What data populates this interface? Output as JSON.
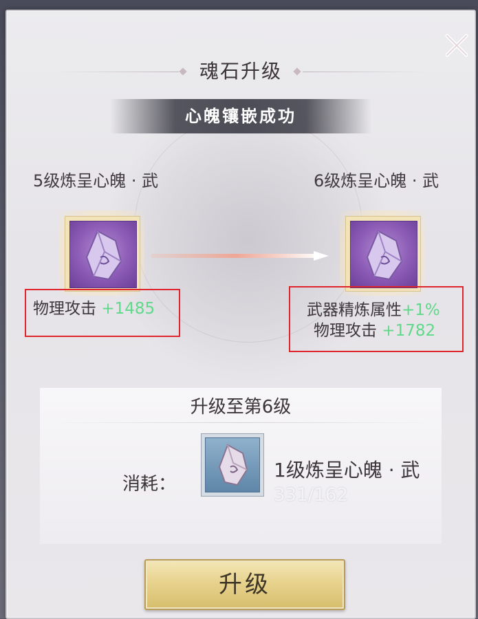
{
  "dialog": {
    "title": "魂石升级",
    "banner": "心魄镶嵌成功",
    "close_icon": "close-x-icon"
  },
  "current_item": {
    "name": "5级炼呈心魄 · 武",
    "icon": "soul-stone-crystal-icon",
    "stats": [
      {
        "label": "物理攻击",
        "value": "+1485"
      }
    ]
  },
  "next_item": {
    "name": "6级炼呈心魄 · 武",
    "icon": "soul-stone-crystal-icon",
    "stats": [
      {
        "label": "武器精炼属性",
        "value": "+1%"
      },
      {
        "label": "物理攻击",
        "value": "+1782"
      }
    ]
  },
  "upgrade": {
    "target_text": "升级至第6级",
    "consume_label": "消耗：",
    "material_name": "1级炼呈心魄 · 武",
    "material_count": "331/162",
    "material_icon": "soul-stone-material-icon",
    "button_label": "升级"
  },
  "colors": {
    "stat_value_green": "#5fd88a",
    "highlight_box_red": "#e0242c",
    "button_gold": "#e8d38e",
    "slot_purple": "#8b5bb5",
    "slot_blue": "#5f86a8"
  }
}
